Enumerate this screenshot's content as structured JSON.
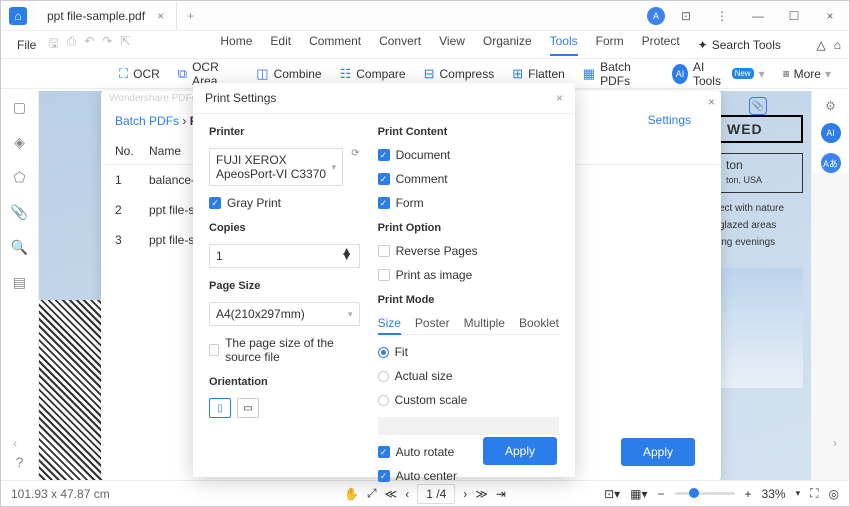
{
  "titlebar": {
    "tab_title": "ppt file-sample.pdf"
  },
  "menubar": {
    "file": "File",
    "items": [
      "Home",
      "Edit",
      "Comment",
      "Convert",
      "View",
      "Organize",
      "Tools",
      "Form",
      "Protect"
    ],
    "active": 6,
    "search": "Search Tools"
  },
  "toolbar": {
    "ocr": "OCR",
    "ocr_area": "OCR Area",
    "combine": "Combine",
    "compare": "Compare",
    "compress": "Compress",
    "flatten": "Flatten",
    "batch": "Batch PDFs",
    "ai": "AI Tools",
    "ai_badge": "New",
    "more": "More"
  },
  "batch": {
    "watermark": "Wondershare PDFelement",
    "breadcrumb_root": "Batch PDFs",
    "breadcrumb_sep": " › ",
    "breadcrumb_current": "Pr",
    "settings": "Settings",
    "headers": {
      "no": "No.",
      "name": "Name"
    },
    "rows": [
      {
        "no": "1",
        "name": "balance-she"
      },
      {
        "no": "2",
        "name": "ppt file-sam"
      },
      {
        "no": "3",
        "name": "ppt file-sam"
      }
    ],
    "apply": "Apply"
  },
  "print": {
    "title": "Print Settings",
    "printer_label": "Printer",
    "printer_value": "FUJI XEROX ApeosPort-VI C3370",
    "gray": "Gray Print",
    "copies_label": "Copies",
    "copies_value": "1",
    "pagesize_label": "Page Size",
    "pagesize_value": "A4(210x297mm)",
    "source_size": "The page size of the source file",
    "orientation_label": "Orientation",
    "content_label": "Print Content",
    "content_doc": "Document",
    "content_comment": "Comment",
    "content_form": "Form",
    "option_label": "Print Option",
    "reverse": "Reverse Pages",
    "as_image": "Print as image",
    "mode_label": "Print Mode",
    "tabs": [
      "Size",
      "Poster",
      "Multiple",
      "Booklet"
    ],
    "active_tab": 0,
    "fit": "Fit",
    "actual": "Actual size",
    "custom": "Custom scale",
    "auto_rotate": "Auto rotate",
    "auto_center": "Auto center",
    "apply": "Apply"
  },
  "preview": {
    "brand": "WED",
    "loc": "ton",
    "country": "ton, USA",
    "t1": "ect with nature",
    "t2": "glazed areas",
    "t3": "ing evenings"
  },
  "status": {
    "coords": "101.93 x 47.87 cm",
    "page": "1",
    "total": "/4",
    "zoom": "33%"
  }
}
